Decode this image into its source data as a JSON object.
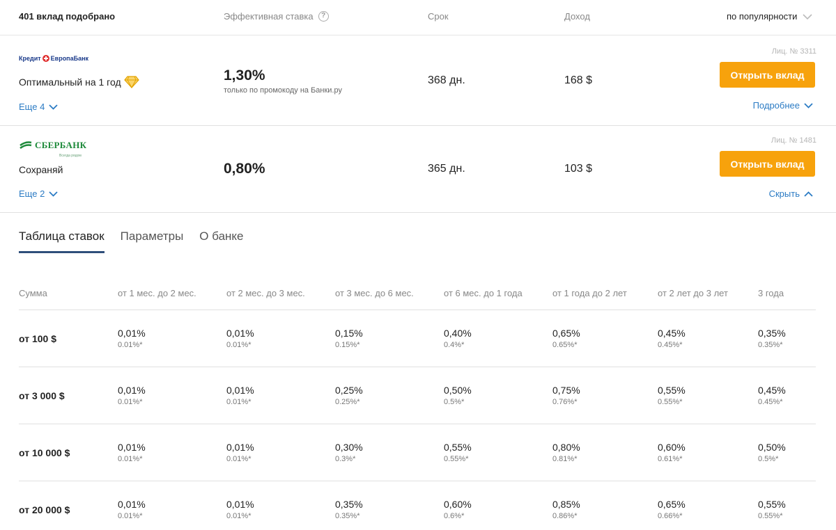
{
  "header": {
    "count": "401 вклад подобрано",
    "rate": "Эффективная ставка",
    "help": "?",
    "term": "Срок",
    "income": "Доход",
    "sort": "по популярности"
  },
  "deposits": [
    {
      "bank": "Кредит Европа Банк",
      "bank_parts": [
        "Кредит",
        "ЕвропаБанк"
      ],
      "name": "Оптимальный на 1 год",
      "more": "Еще 4",
      "rate": "1,30%",
      "rate_note": "только по промокоду на Банки.ру",
      "term": "368 дн.",
      "income": "168 $",
      "license": "Лиц. № 3311",
      "button": "Открыть вклад",
      "detail": "Подробнее",
      "badge_icon": "diamond-icon"
    },
    {
      "bank": "СБЕРБАНК",
      "bank_sub": "Всегда рядом",
      "name": "Сохраняй",
      "more": "Еще 2",
      "rate": "0,80%",
      "term": "365 дн.",
      "income": "103 $",
      "license": "Лиц. № 1481",
      "button": "Открыть вклад",
      "detail": "Скрыть"
    }
  ],
  "tabs": [
    "Таблица ставок",
    "Параметры",
    "О банке"
  ],
  "rate_table": {
    "columns": [
      "Сумма",
      "от 1 мес. до 2 мес.",
      "от 2 мес. до 3 мес.",
      "от 3 мес. до 6 мес.",
      "от 6 мес. до 1 года",
      "от 1 года до 2 лет",
      "от 2 лет до 3 лет",
      "3 года"
    ],
    "rows": [
      {
        "amount": "от 100 $",
        "rates": [
          "0,01%",
          "0,01%",
          "0,15%",
          "0,40%",
          "0,65%",
          "0,45%",
          "0,35%"
        ],
        "effective": [
          "0.01%*",
          "0.01%*",
          "0.15%*",
          "0.4%*",
          "0.65%*",
          "0.45%*",
          "0.35%*"
        ]
      },
      {
        "amount": "от 3 000 $",
        "rates": [
          "0,01%",
          "0,01%",
          "0,25%",
          "0,50%",
          "0,75%",
          "0,55%",
          "0,45%"
        ],
        "effective": [
          "0.01%*",
          "0.01%*",
          "0.25%*",
          "0.5%*",
          "0.76%*",
          "0.55%*",
          "0.45%*"
        ]
      },
      {
        "amount": "от 10 000 $",
        "rates": [
          "0,01%",
          "0,01%",
          "0,30%",
          "0,55%",
          "0,80%",
          "0,60%",
          "0,50%"
        ],
        "effective": [
          "0.01%*",
          "0.01%*",
          "0.3%*",
          "0.55%*",
          "0.81%*",
          "0.61%*",
          "0.5%*"
        ]
      },
      {
        "amount": "от 20 000 $",
        "rates": [
          "0,01%",
          "0,01%",
          "0,35%",
          "0,60%",
          "0,85%",
          "0,65%",
          "0,55%"
        ],
        "effective": [
          "0.01%*",
          "0.01%*",
          "0.35%*",
          "0.6%*",
          "0.86%*",
          "0.66%*",
          "0.55%*"
        ]
      }
    ]
  },
  "colors": {
    "accent": "#f7a20c",
    "link": "#2b7bc4",
    "sber_green": "#1d8a3a",
    "tab_underline": "#2f4f7a"
  }
}
